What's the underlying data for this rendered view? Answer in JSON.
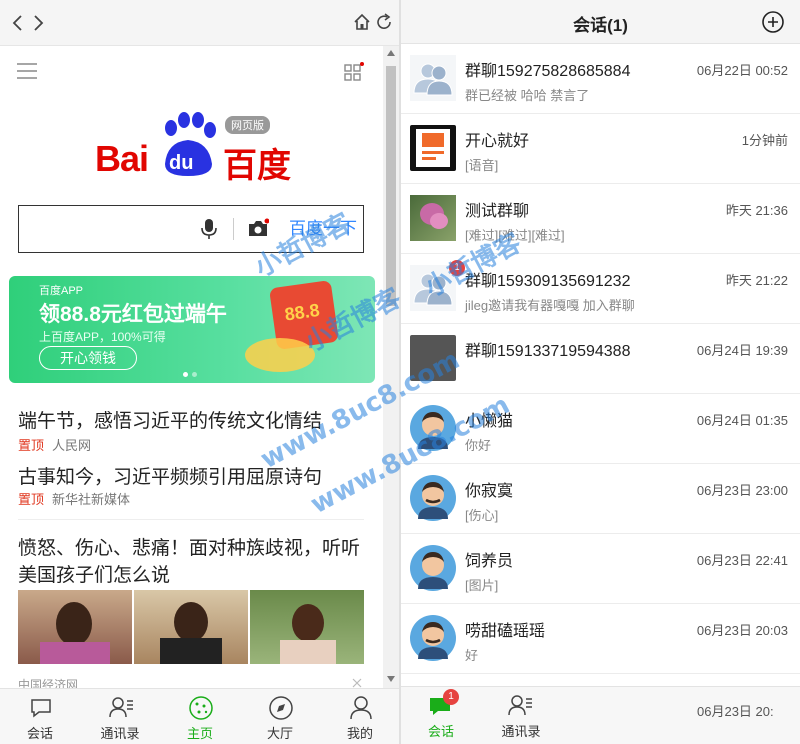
{
  "left": {
    "logo_badge": "网页版",
    "logo_text_bai": "Bai",
    "logo_text_du": "du",
    "logo_text_cn": "百度",
    "search_button": "百度一下",
    "banner": {
      "brand": "百度APP",
      "headline": "领88.8元红包过端午",
      "sub": "上百度APP，100%可得",
      "button": "开心领钱",
      "coupon": "88.8"
    },
    "news": [
      {
        "title": "端午节，感悟习近平的传统文化情结",
        "tag": "置顶",
        "source": "人民网"
      },
      {
        "title": "古事知今，习近平频频引用屈原诗句",
        "tag": "置顶",
        "source": "新华社新媒体"
      },
      {
        "title_line1": "愤怒、伤心、悲痛！面对种族歧视，听听",
        "title_line2": "美国孩子们怎么说"
      }
    ],
    "footer_source": "中国经济网",
    "tabs": [
      "会话",
      "通讯录",
      "主页",
      "大厅",
      "我的"
    ]
  },
  "right": {
    "title": "会话(1)",
    "conversations": [
      {
        "name": "群聊159275828685884",
        "time": "06月22日 00:52",
        "preview": "群已经被 哈哈 禁言了"
      },
      {
        "name": "开心就好",
        "time": "1分钟前",
        "preview": "[语音]"
      },
      {
        "name": "测试群聊",
        "time": "昨天 21:36",
        "preview": "[难过][难过][难过]"
      },
      {
        "name": "群聊159309135691232",
        "time": "昨天 21:22",
        "preview": "jileg邀请我有器嘎嘎 加入群聊"
      },
      {
        "name": "群聊159133719594388",
        "time": "06月24日 19:39",
        "preview": ""
      },
      {
        "name": "小懒猫",
        "time": "06月24日 01:35",
        "preview": "你好"
      },
      {
        "name": "你寂寞",
        "time": "06月23日 23:00",
        "preview": "[伤心]"
      },
      {
        "name": "饲养员",
        "time": "06月23日 22:41",
        "preview": "[图片]"
      },
      {
        "name": "唠甜磕瑶瑶",
        "time": "06月23日 20:03",
        "preview": "好"
      }
    ],
    "tabs": [
      "会话",
      "通讯录"
    ],
    "badge": "1",
    "partial_time": "06月23日 20:"
  },
  "watermark": [
    "小哲博客",
    "www.8uc8.com"
  ],
  "colors": {
    "accent_green": "#1aad19",
    "baidu_blue": "#2932e1",
    "baidu_red": "#e10601",
    "link_blue": "#3388ff"
  }
}
